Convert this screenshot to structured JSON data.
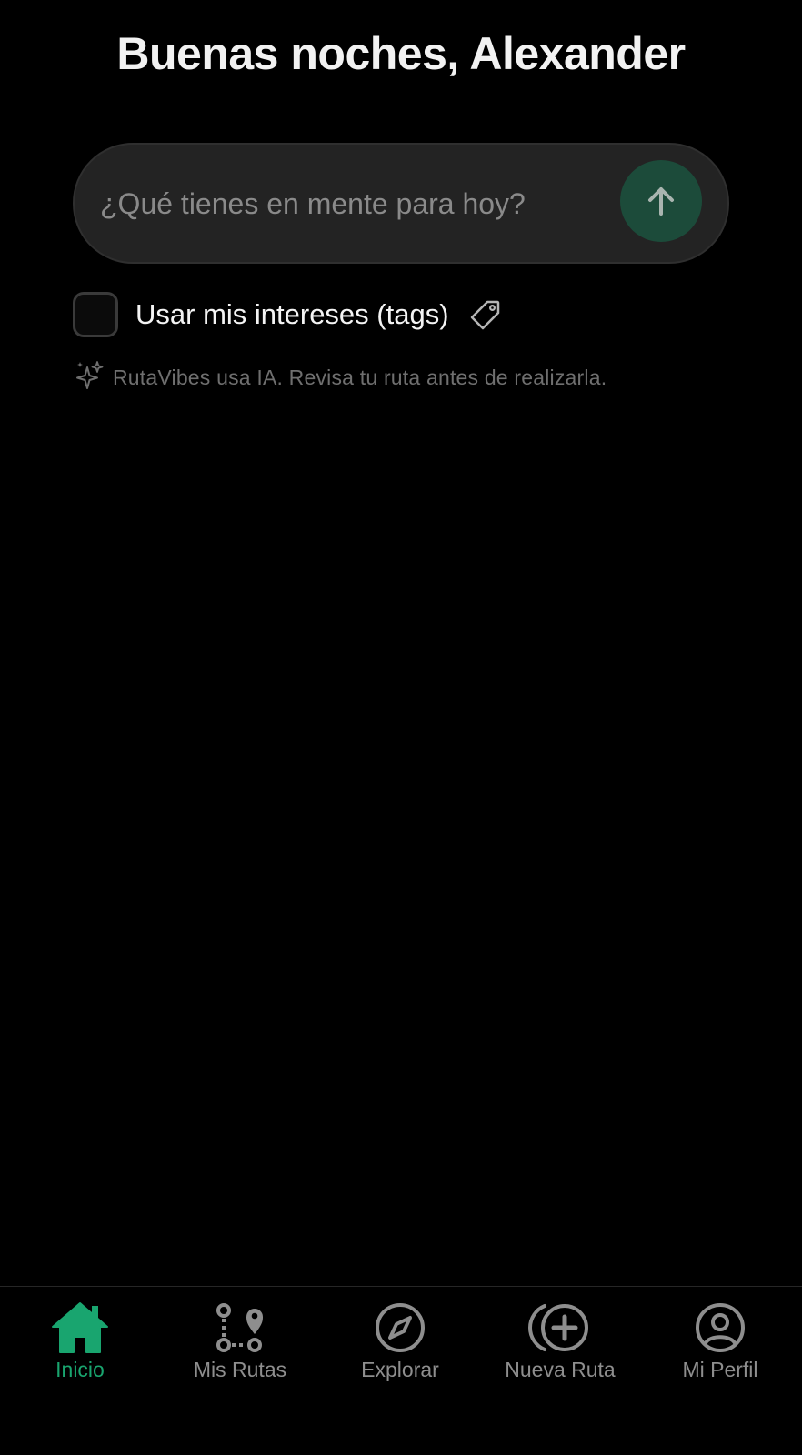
{
  "header": {
    "greeting": "Buenas noches, Alexander"
  },
  "prompt": {
    "placeholder": "¿Qué tienes en mente para hoy?",
    "value": "",
    "send_icon": "arrow-up-icon"
  },
  "interests": {
    "label": "Usar mis intereses (tags)",
    "checked": false,
    "icon": "tag-icon"
  },
  "disclaimer": {
    "icon": "sparkles-icon",
    "text": "RutaVibes usa IA. Revisa tu ruta antes de realizarla."
  },
  "tabbar": {
    "active": "Inicio",
    "tabs": [
      {
        "label": "Inicio",
        "icon": "home-icon"
      },
      {
        "label": "Mis Rutas",
        "icon": "route-icon"
      },
      {
        "label": "Explorar",
        "icon": "compass-icon"
      },
      {
        "label": "Nueva Ruta",
        "icon": "add-route-icon"
      },
      {
        "label": "Mi Perfil",
        "icon": "profile-icon"
      }
    ]
  },
  "colors": {
    "background": "#000000",
    "accent": "#19a56f",
    "send_button": "#1c4b3a",
    "input_background": "#232323",
    "inactive_tab": "#8e8e8e"
  }
}
